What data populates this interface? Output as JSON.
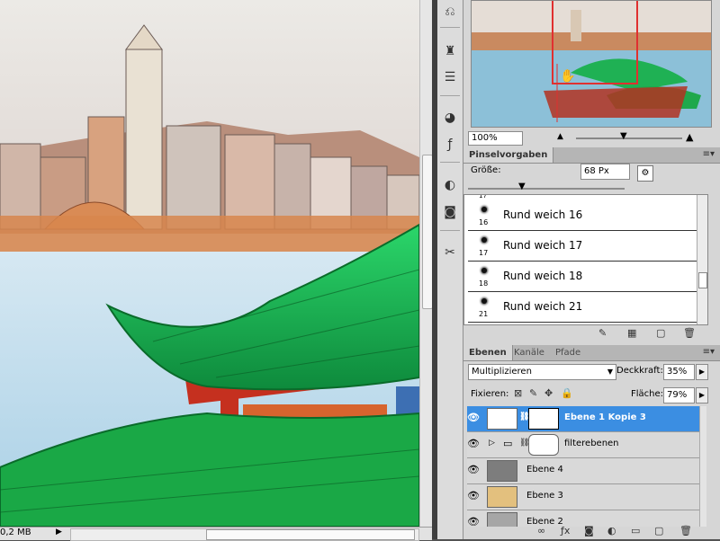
{
  "status": {
    "file_size": "0,2 MB"
  },
  "navigator": {
    "zoom": "100%"
  },
  "brush_presets": {
    "tab_label": "Pinselvorgaben",
    "size_label": "Größe:",
    "size_value": "68 Px",
    "partial_number": "17",
    "items": [
      {
        "name": "Rund weich 16",
        "size": "16"
      },
      {
        "name": "Rund weich 17",
        "size": "17"
      },
      {
        "name": "Rund weich 18",
        "size": "18"
      },
      {
        "name": "Rund weich 21",
        "size": "21"
      }
    ]
  },
  "layers_panel": {
    "tabs": [
      "Ebenen",
      "Kanäle",
      "Pfade"
    ],
    "blend_mode": "Multiplizieren",
    "opacity_label": "Deckkraft:",
    "opacity_value": "35%",
    "lock_label": "Fixieren:",
    "fill_label": "Fläche:",
    "fill_value": "79%",
    "layers": [
      {
        "name": "Ebene 1 Kopie 3",
        "selected": true
      },
      {
        "name": "filterebenen",
        "selected": false
      },
      {
        "name": "Ebene 4",
        "selected": false
      },
      {
        "name": "Ebene 3",
        "selected": false
      },
      {
        "name": "Ebene 2",
        "selected": false
      }
    ]
  },
  "colors": {
    "selection": "#3b8ee2",
    "panel_bg": "#d6d6d6",
    "accent_frame": "#e03030"
  }
}
